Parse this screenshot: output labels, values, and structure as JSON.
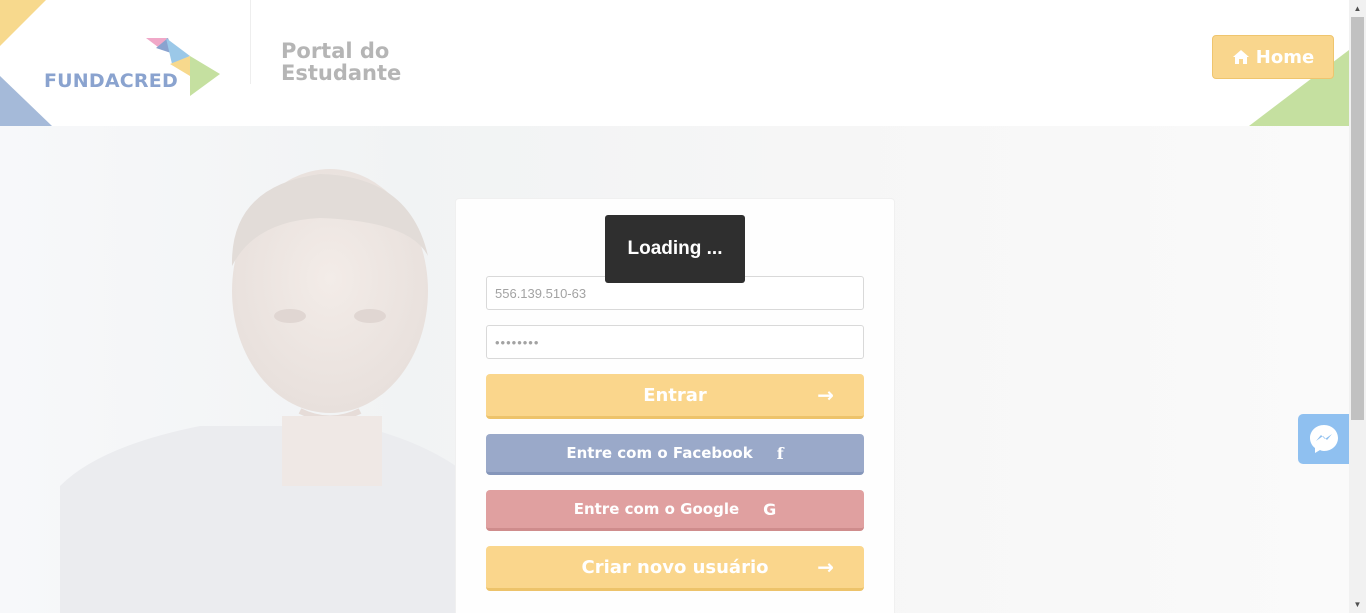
{
  "header": {
    "logo_text": "FUNDACRED",
    "portal_title_line1": "Portal do",
    "portal_title_line2": "Estudante",
    "home_label": "Home"
  },
  "login": {
    "cpf_value": "556.139.510-63",
    "password_mask": "••••••••",
    "entrar_label": "Entrar",
    "facebook_label": "Entre com o Facebook",
    "google_label": "Entre com o Google",
    "criar_label": "Criar novo usuário",
    "arrow": "→",
    "fb_icon": "f",
    "google_icon": "G"
  },
  "overlay": {
    "loading_text": "Loading ..."
  },
  "colors": {
    "accent_yellow": "#fad68c",
    "facebook": "#9aa9c9",
    "google": "#e0a0a0",
    "logo_blue": "#8aa3cf",
    "messenger": "#8fc0f0"
  },
  "icons": {
    "home": "home-icon",
    "messenger": "messenger-icon",
    "arrow": "arrow-right-icon"
  }
}
